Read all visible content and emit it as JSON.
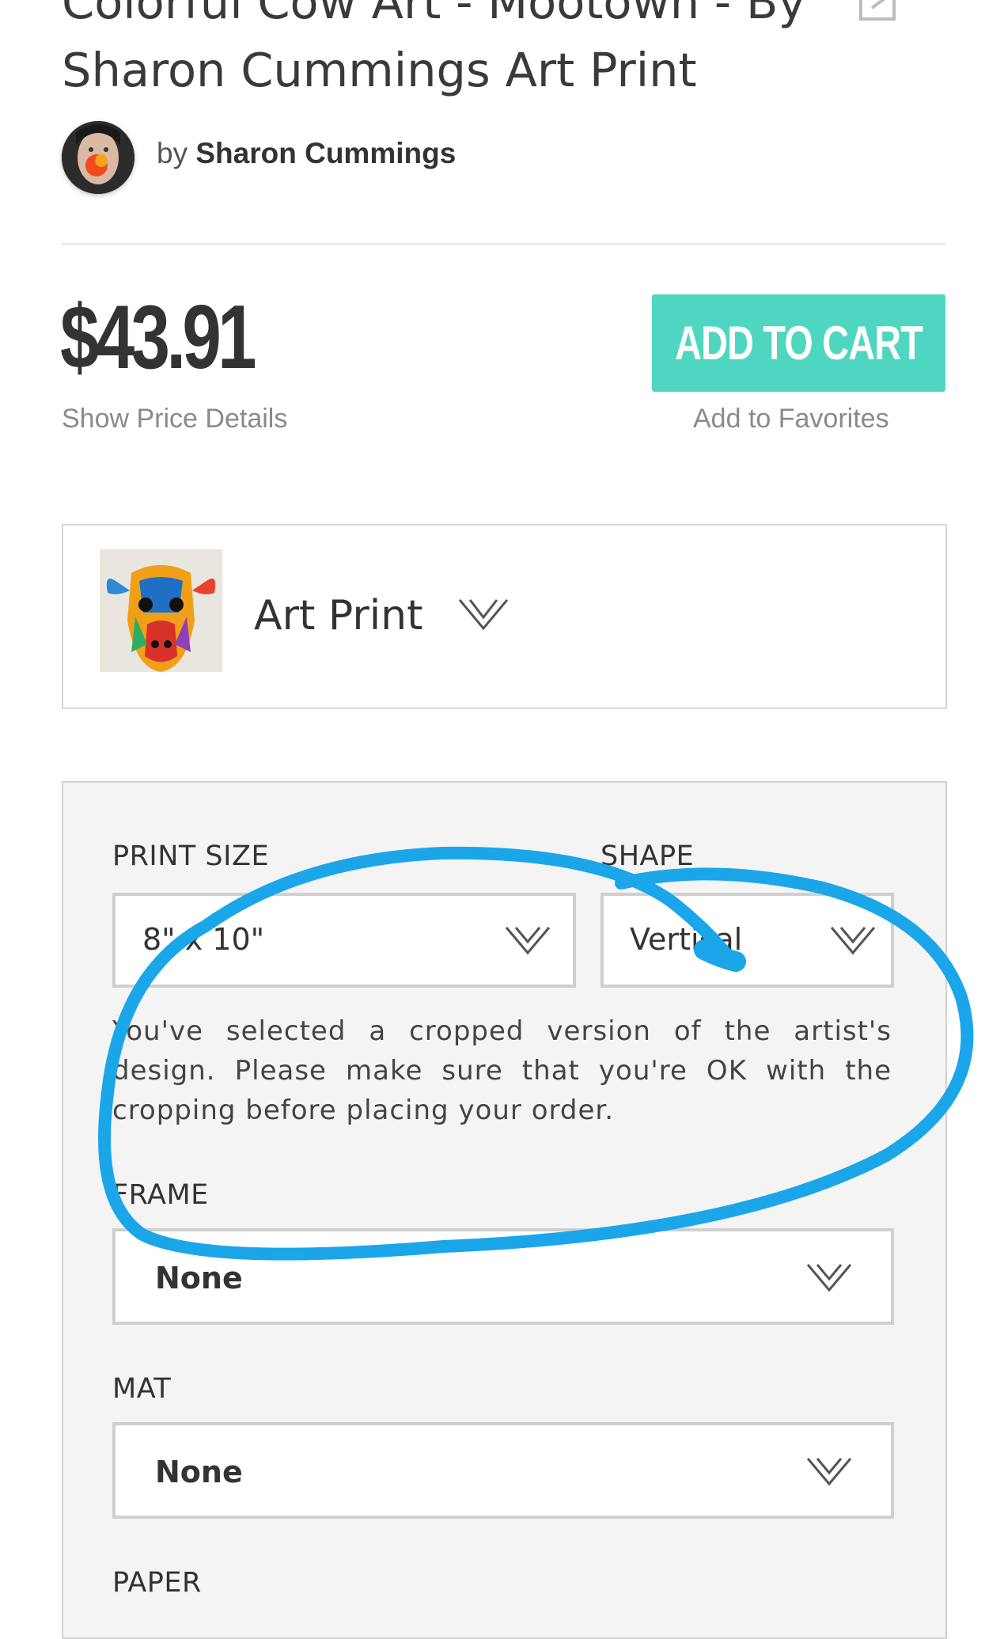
{
  "product": {
    "title": "Colorful Cow Art - Mootown - By Sharon Cummings Art Print",
    "by_prefix": "by",
    "artist": "Sharon Cummings",
    "price": "$43.91",
    "show_price_details": "Show Price Details",
    "add_to_cart": "ADD TO CART",
    "add_to_favorites": "Add to Favorites",
    "type": "Art Print"
  },
  "options": {
    "print_size": {
      "label": "PRINT SIZE",
      "value": "8\" x 10\""
    },
    "shape": {
      "label": "SHAPE",
      "value": "Vertical"
    },
    "notice": "You've selected a cropped version of the artist's design. Please make sure that you're OK with the cropping before placing your order.",
    "frame": {
      "label": "FRAME",
      "value": "None"
    },
    "mat": {
      "label": "MAT",
      "value": "None"
    },
    "paper": {
      "label": "PAPER"
    }
  },
  "colors": {
    "accent": "#4fd6c0",
    "annotation_stroke": "#1aa6e8"
  },
  "icons": {
    "share": "share-icon",
    "chevron": "chevron-down-icon"
  }
}
